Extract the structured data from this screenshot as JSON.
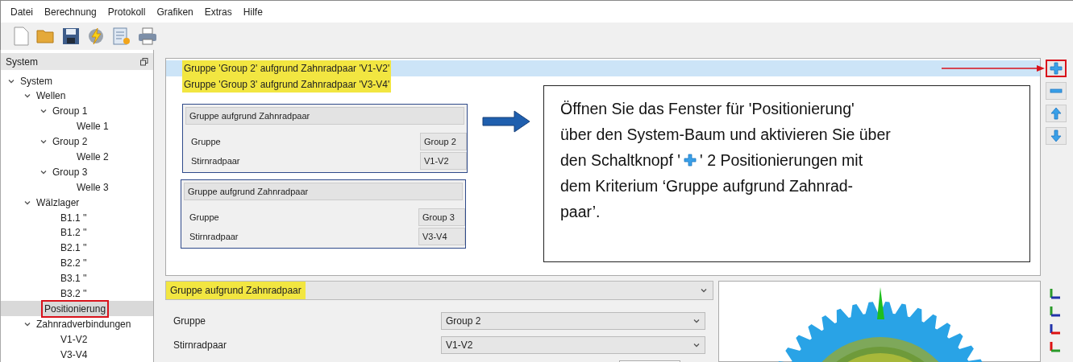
{
  "menu": [
    "Datei",
    "Berechnung",
    "Protokoll",
    "Grafiken",
    "Extras",
    "Hilfe"
  ],
  "sidebar": {
    "title": "System",
    "tree": [
      {
        "label": "System",
        "expanded": true,
        "selected": false,
        "annotated": false,
        "children": [
          {
            "label": "Wellen",
            "expanded": true,
            "selected": false,
            "annotated": false,
            "children": [
              {
                "label": "Group 1",
                "expanded": true,
                "selected": false,
                "annotated": false,
                "children": [
                  {
                    "label": "Welle 1",
                    "selected": false,
                    "annotated": false
                  }
                ]
              },
              {
                "label": "Group 2",
                "expanded": true,
                "selected": false,
                "annotated": false,
                "children": [
                  {
                    "label": "Welle 2",
                    "selected": false,
                    "annotated": false
                  }
                ]
              },
              {
                "label": "Group 3",
                "expanded": true,
                "selected": false,
                "annotated": false,
                "children": [
                  {
                    "label": "Welle 3",
                    "selected": false,
                    "annotated": false
                  }
                ]
              }
            ]
          },
          {
            "label": "Wälzlager",
            "expanded": true,
            "selected": false,
            "annotated": false,
            "children": [
              {
                "label": "B1.1 ''",
                "selected": false,
                "annotated": false
              },
              {
                "label": "B1.2 ''",
                "selected": false,
                "annotated": false
              },
              {
                "label": "B2.1 ''",
                "selected": false,
                "annotated": false
              },
              {
                "label": "B2.2 ''",
                "selected": false,
                "annotated": false
              },
              {
                "label": "B3.1 ''",
                "selected": false,
                "annotated": false
              },
              {
                "label": "B3.2 ''",
                "selected": false,
                "annotated": false
              }
            ]
          },
          {
            "label": "Positionierung",
            "selected": true,
            "annotated": true
          },
          {
            "label": "Zahnradverbindungen",
            "expanded": true,
            "selected": false,
            "annotated": false,
            "children": [
              {
                "label": "V1-V2",
                "selected": false,
                "annotated": false
              },
              {
                "label": "V3-V4",
                "selected": false,
                "annotated": false
              }
            ]
          }
        ]
      }
    ]
  },
  "positions": [
    {
      "label": "Gruppe 'Group 2' aufgrund Zahnradpaar 'V1-V2'",
      "selected": true,
      "highlighted": true
    },
    {
      "label": "Gruppe 'Group 3' aufgrund Zahnradpaar 'V3-V4'",
      "selected": false,
      "highlighted": true
    }
  ],
  "group_cards": [
    {
      "title": "Gruppe aufgrund Zahnradpaar",
      "rows": [
        {
          "label": "Gruppe",
          "value": "Group 2"
        },
        {
          "label": "Stirnradpaar",
          "value": "V1-V2"
        }
      ]
    },
    {
      "title": "Gruppe aufgrund Zahnradpaar",
      "rows": [
        {
          "label": "Gruppe",
          "value": "Group 3"
        },
        {
          "label": "Stirnradpaar",
          "value": "V3-V4"
        }
      ]
    }
  ],
  "callout": {
    "lines": [
      {
        "kind": "text",
        "text": "Öffnen Sie das Fenster für 'Positionierung'"
      },
      {
        "kind": "text",
        "text": "über den System-Baum und aktivieren Sie über"
      },
      {
        "kind": "with_icon",
        "text": "den Schaltknopf '",
        "text_after": "' 2 Positionierungen mit"
      },
      {
        "kind": "text",
        "text": "dem Kriterium ‘Gruppe aufgrund Zahnrad-"
      },
      {
        "kind": "text",
        "text": "paar’."
      }
    ]
  },
  "side_buttons": [
    {
      "kind": "add",
      "annotated": true
    },
    {
      "kind": "remove",
      "annotated": false
    },
    {
      "kind": "up",
      "annotated": false
    },
    {
      "kind": "down",
      "annotated": false
    }
  ],
  "criterion": {
    "value": "Gruppe aufgrund Zahnradpaar",
    "highlighted": true
  },
  "fields": [
    {
      "label": "Gruppe",
      "value": "Group 2"
    },
    {
      "label": "Stirnradpaar",
      "value": "V1-V2"
    }
  ]
}
